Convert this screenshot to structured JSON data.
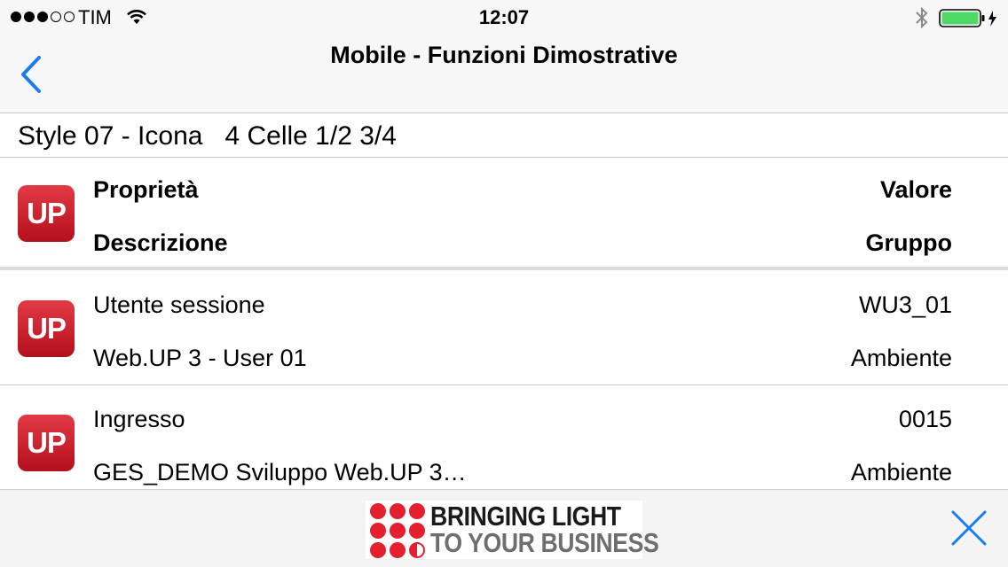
{
  "status_bar": {
    "carrier": "TIM",
    "time": "12:07",
    "signal_bars": 3,
    "signal_total": 5,
    "battery_level": 1.0,
    "icons": [
      "signal-dots-icon",
      "wifi-icon",
      "bluetooth-icon",
      "battery-icon",
      "charging-bolt-icon"
    ]
  },
  "nav": {
    "title": "Mobile - Funzioni Dimostrative",
    "back_icon": "chevron-left-icon"
  },
  "section": {
    "title": "Style 07 - Icona   4 Celle 1/2 3/4"
  },
  "table": {
    "icon_label": "UP",
    "header": {
      "top_left": "Proprietà",
      "top_right": "Valore",
      "bottom_left": "Descrizione",
      "bottom_right": "Gruppo"
    },
    "rows": [
      {
        "top_left": "Utente sessione",
        "top_right": "WU3_01",
        "bottom_left": "Web.UP 3 - User 01",
        "bottom_right": "Ambiente"
      },
      {
        "top_left": "Ingresso",
        "top_right": "0015",
        "bottom_left": "GES_DEMO  Sviluppo Web.UP 3…",
        "bottom_right": "Ambiente"
      }
    ]
  },
  "banner": {
    "line1": "BRINGING LIGHT",
    "line2": "TO YOUR BUSINESS",
    "close_icon": "close-icon",
    "colors": {
      "dots": "#e4202e",
      "line1": "#1a1a1a",
      "line2": "#6d6e70"
    }
  },
  "colors": {
    "accent": "#1a7cf2",
    "icon_red": "#d0202e",
    "battery_green": "#4cd964"
  }
}
